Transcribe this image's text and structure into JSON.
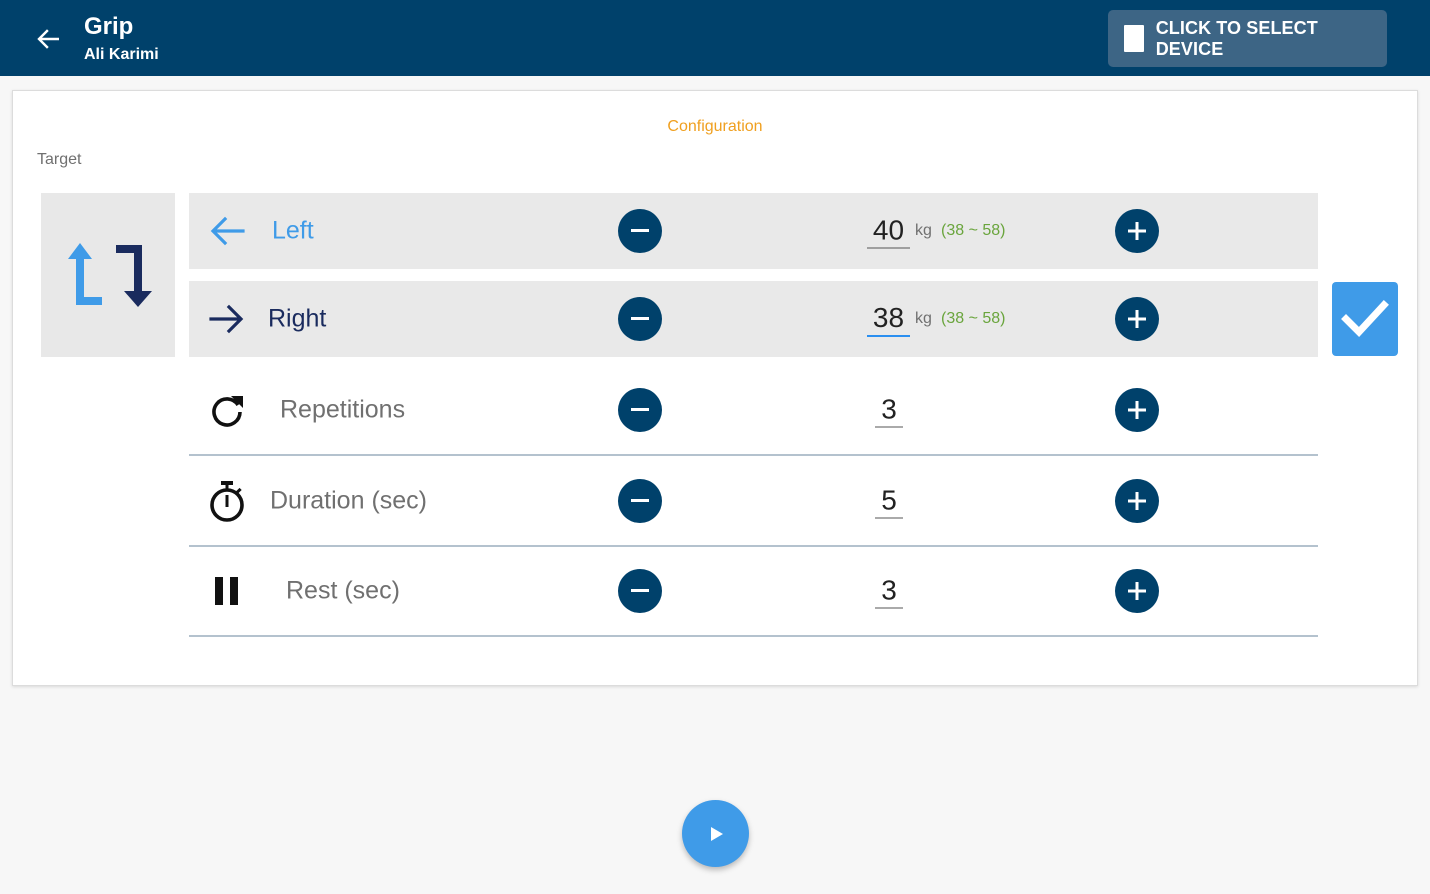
{
  "appbar": {
    "title": "Grip",
    "subtitle": "Ali Karimi",
    "device_button_label": "CLICK TO SELECT DEVICE",
    "background_color": "#00416b"
  },
  "config": {
    "title": "Configuration",
    "target_label": "Target",
    "swap_icon": "swap-arrows-icon",
    "left": {
      "label": "Left",
      "icon": "arrow-left-icon",
      "value": "40",
      "unit": "kg",
      "range": "(38 ~ 58)"
    },
    "right": {
      "label": "Right",
      "icon": "arrow-right-icon",
      "value": "38",
      "unit": "kg",
      "range": "(38 ~ 58)",
      "selected": true
    },
    "repetitions": {
      "label": "Repetitions",
      "icon": "repeat-icon",
      "value": "3"
    },
    "duration": {
      "label": "Duration (sec)",
      "icon": "stopwatch-icon",
      "value": "5"
    },
    "rest": {
      "label": "Rest (sec)",
      "icon": "pause-icon",
      "value": "3"
    }
  },
  "fab": {
    "icon": "play-icon"
  },
  "colors": {
    "accent_blue": "#3f9be8",
    "navy": "#00416b",
    "orange": "#f0a020",
    "green": "#6aa53d"
  }
}
